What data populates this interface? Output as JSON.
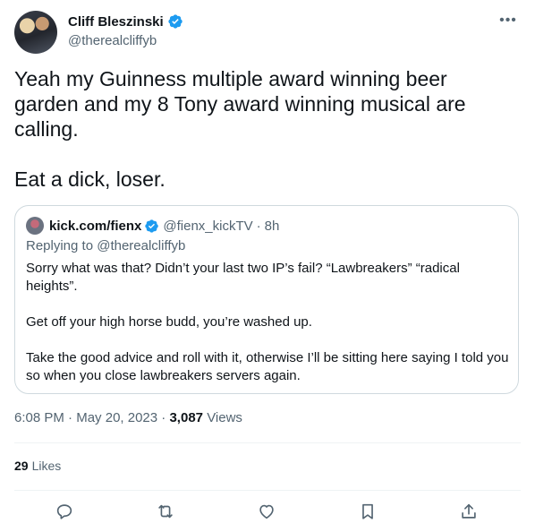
{
  "author": {
    "display_name": "Cliff Bleszinski",
    "handle": "@therealcliffyb",
    "verified": true
  },
  "more_icon": "more-horizontal-icon",
  "tweet_text": "Yeah my Guinness multiple award winning beer garden and my 8 Tony award winning musical are calling.\n\nEat a dick, loser.",
  "quote": {
    "display_name": "kick.com/fienx",
    "handle": "@fienx_kickTV",
    "separator": "·",
    "time": "8h",
    "replying_prefix": "Replying to",
    "replying_to": "@therealcliffyb",
    "paragraphs": [
      "Sorry what was that? Didn’t your last two IP’s fail? “Lawbreakers” “radical heights”.",
      "Get off your high horse budd, you’re washed up.",
      "Take the good advice and roll with it, otherwise I’ll be sitting here saying I told you so when you close lawbreakers servers again."
    ]
  },
  "meta": {
    "time": "6:08 PM",
    "sep1": "·",
    "date": "May 20, 2023",
    "sep2": "·",
    "views_count": "3,087",
    "views_label": "Views"
  },
  "likes": {
    "count": "29",
    "label": "Likes"
  },
  "actions": [
    {
      "name": "reply",
      "icon": "reply-icon"
    },
    {
      "name": "retweet",
      "icon": "retweet-icon"
    },
    {
      "name": "like",
      "icon": "heart-icon"
    },
    {
      "name": "bookmark",
      "icon": "bookmark-icon"
    },
    {
      "name": "share",
      "icon": "share-icon"
    }
  ],
  "colors": {
    "verified": "#1d9bf0",
    "text_primary": "#0f1419",
    "text_secondary": "#536471",
    "border": "#cfd9de",
    "divider": "#eff3f4"
  }
}
